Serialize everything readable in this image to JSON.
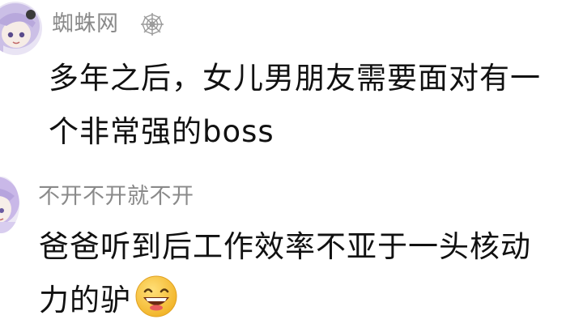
{
  "comments": [
    {
      "username": "蜘蛛网",
      "badge_icon": "spider-web-icon",
      "text_line1": "多年之后，女儿男朋友需要面对有一",
      "text_line2": "个非常强的boss"
    },
    {
      "username": "不开不开就不开",
      "text_line1": "爸爸听到后工作效率不亚于一头核动",
      "text_line2": "力的驴",
      "emoji_icon": "grinning-face-emoji"
    }
  ],
  "colors": {
    "username": "#8a8a8a",
    "text": "#111111",
    "emoji_face": "#f7c531",
    "avatar_hair": "#c9b8e8"
  }
}
